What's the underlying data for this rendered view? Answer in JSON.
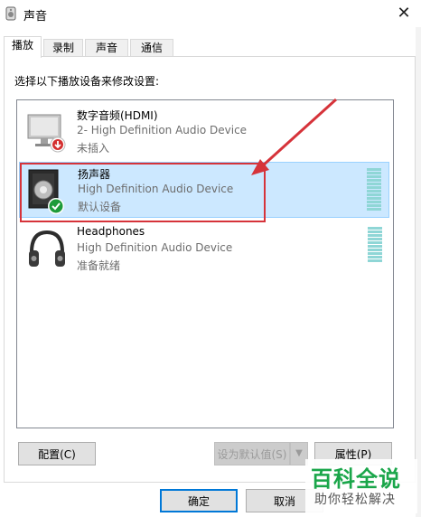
{
  "window": {
    "title": "声音",
    "close_glyph": "✕"
  },
  "tabs": [
    {
      "label": "播放",
      "active": true
    },
    {
      "label": "录制",
      "active": false
    },
    {
      "label": "声音",
      "active": false
    },
    {
      "label": "通信",
      "active": false
    }
  ],
  "instruction": "选择以下播放设备来修改设置:",
  "devices": [
    {
      "name": "数字音频(HDMI)",
      "desc": "2- High Definition Audio Device",
      "status": "未插入",
      "icon": "monitor-icon",
      "badge": "unplugged-badge",
      "selected": false
    },
    {
      "name": "扬声器",
      "desc": "High Definition Audio Device",
      "status": "默认设备",
      "icon": "speaker-icon",
      "badge": "default-check-badge",
      "selected": true
    },
    {
      "name": "Headphones",
      "desc": "High Definition Audio Device",
      "status": "准备就绪",
      "icon": "headphones-icon",
      "badge": "",
      "selected": false
    }
  ],
  "buttons": {
    "configure": "配置(C)",
    "set_default": "设为默认值(S)",
    "properties": "属性(P)",
    "ok": "确定",
    "cancel": "取消"
  },
  "watermark": {
    "main": "百科全说",
    "sub": "助你轻松解决"
  },
  "colors": {
    "selection_bg": "#cce8ff",
    "highlight": "#d6333a",
    "accent": "#0078d7",
    "watermark": "#1aa64a"
  }
}
